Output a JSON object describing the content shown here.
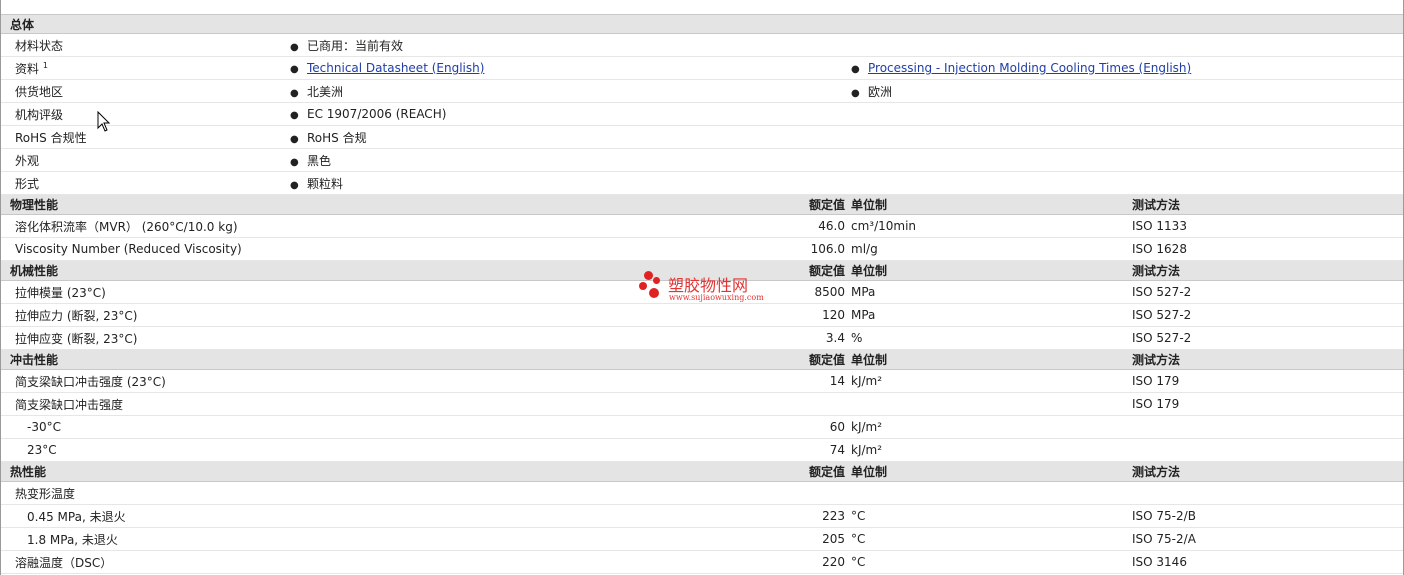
{
  "general": {
    "title": "总体",
    "rows": {
      "status": {
        "label": "材料状态",
        "value": "已商用：当前有效"
      },
      "docs": {
        "label": "资料",
        "sup": "1",
        "link1": "Technical Datasheet (English)",
        "link2": "Processing - Injection Molding Cooling Times (English)"
      },
      "region": {
        "label": "供货地区",
        "value1": "北美洲",
        "value2": "欧洲"
      },
      "agency": {
        "label": "机构评级",
        "value": "EC 1907/2006 (REACH)"
      },
      "rohs": {
        "label": "RoHS 合规性",
        "value": "RoHS 合规"
      },
      "appearance": {
        "label": "外观",
        "value": "黑色"
      },
      "form": {
        "label": "形式",
        "value": "颗粒料"
      }
    }
  },
  "headers": {
    "nominal": "额定值",
    "unit": "单位制",
    "test": "测试方法"
  },
  "physical": {
    "title": "物理性能",
    "rows": [
      {
        "label": "溶化体积流率（MVR） (260°C/10.0 kg)",
        "value": "46.0",
        "unit": "cm³/10min",
        "test": "ISO 1133"
      },
      {
        "label": "Viscosity Number (Reduced Viscosity)",
        "value": "106.0",
        "unit": "ml/g",
        "test": "ISO 1628"
      }
    ]
  },
  "mechanical": {
    "title": "机械性能",
    "rows": [
      {
        "label": "拉伸模量 (23°C)",
        "value": "8500",
        "unit": "MPa",
        "test": "ISO 527-2"
      },
      {
        "label": "拉伸应力 (断裂, 23°C)",
        "value": "120",
        "unit": "MPa",
        "test": "ISO 527-2"
      },
      {
        "label": "拉伸应变 (断裂, 23°C)",
        "value": "3.4",
        "unit": "%",
        "test": "ISO 527-2"
      }
    ]
  },
  "impact": {
    "title": "冲击性能",
    "rows": [
      {
        "label": "简支梁缺口冲击强度 (23°C)",
        "value": "14",
        "unit": "kJ/m²",
        "test": "ISO 179"
      },
      {
        "label": "简支梁缺口冲击强度",
        "value": "",
        "unit": "",
        "test": "ISO 179"
      },
      {
        "label": "-30°C",
        "value": "60",
        "unit": "kJ/m²",
        "test": ""
      },
      {
        "label": "23°C",
        "value": "74",
        "unit": "kJ/m²",
        "test": ""
      }
    ]
  },
  "thermal": {
    "title": "热性能",
    "rows": [
      {
        "label": "热变形温度",
        "value": "",
        "unit": "",
        "test": ""
      },
      {
        "label": "0.45 MPa, 未退火",
        "value": "223",
        "unit": "°C",
        "test": "ISO 75-2/B"
      },
      {
        "label": "1.8 MPa, 未退火",
        "value": "205",
        "unit": "°C",
        "test": "ISO 75-2/A"
      },
      {
        "label": "溶融温度（DSC）",
        "value": "220",
        "unit": "°C",
        "test": "ISO 3146"
      }
    ]
  },
  "watermark": {
    "name": "塑胶物性网",
    "url": "www.sujiaowuxing.com"
  },
  "colors": {
    "link": "#1f3ea8",
    "section_bg": "#e4e4e4",
    "watermark": "#e23434"
  }
}
